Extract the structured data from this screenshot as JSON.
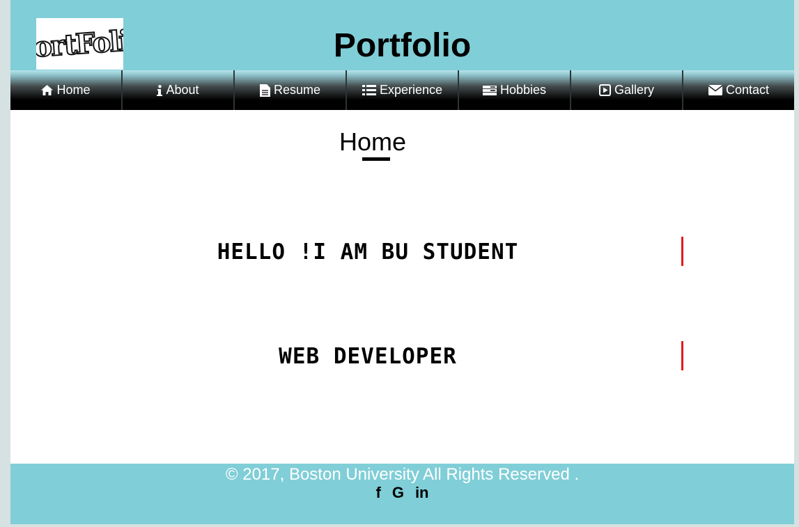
{
  "header": {
    "logo_text": "PortFolio",
    "title": "Portfolio"
  },
  "nav": {
    "items": [
      {
        "label": "Home",
        "icon": "home-icon"
      },
      {
        "label": "About",
        "icon": "info-icon"
      },
      {
        "label": "Resume",
        "icon": "document-icon"
      },
      {
        "label": "Experience",
        "icon": "list-icon"
      },
      {
        "label": "Hobbies",
        "icon": "hobbies-icon"
      },
      {
        "label": "Gallery",
        "icon": "play-icon"
      },
      {
        "label": "Contact",
        "icon": "envelope-icon"
      }
    ]
  },
  "main": {
    "section_title": "Home",
    "typed_lines": [
      "HELLO !I AM BU STUDENT",
      "WEB DEVELOPER"
    ]
  },
  "footer": {
    "copyright": "© 2017, Boston University All Rights Reserved .",
    "social": [
      {
        "label": "f",
        "icon": "facebook-icon"
      },
      {
        "label": "G",
        "icon": "google-icon"
      },
      {
        "label": "in",
        "icon": "linkedin-icon"
      }
    ]
  },
  "colors": {
    "header_bg": "#80ced7",
    "nav_bg": "#000000",
    "cursor": "#e11b1b"
  }
}
